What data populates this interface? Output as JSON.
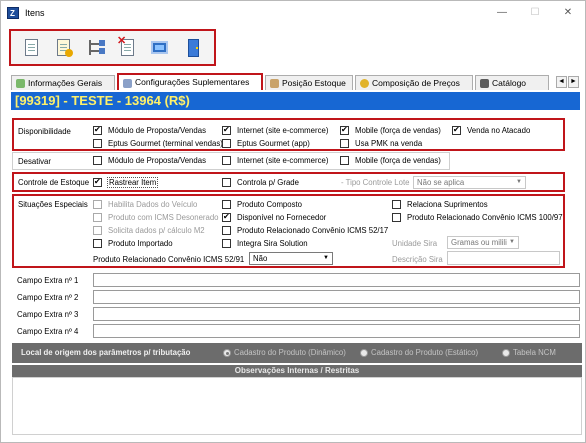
{
  "window": {
    "title": "Itens",
    "app_icon": "Z",
    "minimize": "—",
    "maximize": "☐",
    "close": "✕"
  },
  "toolbar": {
    "buttons": [
      "new-document-icon",
      "edit-document-icon",
      "tree-icon",
      "delete-document-icon",
      "photo-icon",
      "exit-door-icon"
    ]
  },
  "tabs": [
    {
      "label": "Informações Gerais",
      "active": false
    },
    {
      "label": "Configurações Suplementares",
      "active": true
    },
    {
      "label": "Posição Estoque",
      "active": false
    },
    {
      "label": "Composição de Preços",
      "active": false
    },
    {
      "label": "Catálogo",
      "active": false
    }
  ],
  "tab_arrows": {
    "left": "◄",
    "right": "►"
  },
  "banner": {
    "text": "[99319] - TESTE - 13964 (R$)"
  },
  "disponibilidade": {
    "label": "Disponibilidade",
    "items": [
      {
        "label": "Módulo de Proposta/Vendas",
        "checked": true
      },
      {
        "label": "Internet (site e-commerce)",
        "checked": true
      },
      {
        "label": "Mobile (força de vendas)",
        "checked": true
      },
      {
        "label": "Venda no Atacado",
        "checked": true
      },
      {
        "label": "Eptus Gourmet (terminal vendas)",
        "checked": false
      },
      {
        "label": "Eptus Gourmet (app)",
        "checked": false
      },
      {
        "label": "Usa PMK na venda",
        "checked": false
      }
    ]
  },
  "desativar": {
    "label": "Desativar",
    "items": [
      {
        "label": "Módulo de Proposta/Vendas",
        "checked": false
      },
      {
        "label": "Internet (site e-commerce)",
        "checked": false
      },
      {
        "label": "Mobile (força de vendas)",
        "checked": false
      }
    ]
  },
  "controle_estoque": {
    "label": "Controle de Estoque",
    "rastrear": {
      "label": "Rastrear Item",
      "checked": true
    },
    "grade": {
      "label": "Controla p/ Grade",
      "checked": false
    },
    "tipo_label": "- Tipo Controle Lote",
    "tipo_value": "Não se aplica"
  },
  "situacoes": {
    "label": "Situações Especiais",
    "items": [
      {
        "label": "Habilita Dados do Veículo",
        "checked": false,
        "disabled": true
      },
      {
        "label": "Produto com ICMS Desonerado",
        "checked": false,
        "disabled": true
      },
      {
        "label": "Solicita dados p/ cálculo M2",
        "checked": false,
        "disabled": true
      },
      {
        "label": "Produto Importado",
        "checked": false,
        "disabled": false
      },
      {
        "label": "Produto Composto",
        "checked": false,
        "disabled": false
      },
      {
        "label": "Disponível no Fornecedor",
        "checked": true,
        "disabled": false
      },
      {
        "label": "Produto Relacionado Convênio ICMS 52/17",
        "checked": false,
        "disabled": false
      },
      {
        "label": "Integra Sira Solution",
        "checked": false,
        "disabled": false
      },
      {
        "label": "Relaciona Suprimentos",
        "checked": false,
        "disabled": false
      },
      {
        "label": "Produto Relacionado Convênio ICMS 100/97",
        "checked": false,
        "disabled": false
      }
    ],
    "convenio_label": "Produto Relacionado Convênio ICMS 52/91",
    "convenio_value": "Não",
    "unidade_label": "Unidade Sira",
    "unidade_value": "Gramas ou milili",
    "descricao_label": "Descrição Sira"
  },
  "campos_extra": [
    {
      "label": "Campo Extra nº 1",
      "value": ""
    },
    {
      "label": "Campo Extra nº 2",
      "value": ""
    },
    {
      "label": "Campo Extra nº 3",
      "value": ""
    },
    {
      "label": "Campo Extra nº 4",
      "value": ""
    }
  ],
  "tributacao": {
    "label": "Local de origem dos parâmetros p/ tributação",
    "options": [
      {
        "label": "Cadastro do Produto (Dinâmico)",
        "selected": true
      },
      {
        "label": "Cadastro do Produto (Estático)",
        "selected": false
      },
      {
        "label": "Tabela NCM",
        "selected": false
      }
    ]
  },
  "observacoes": {
    "label": "Observações Internas / Restritas"
  }
}
